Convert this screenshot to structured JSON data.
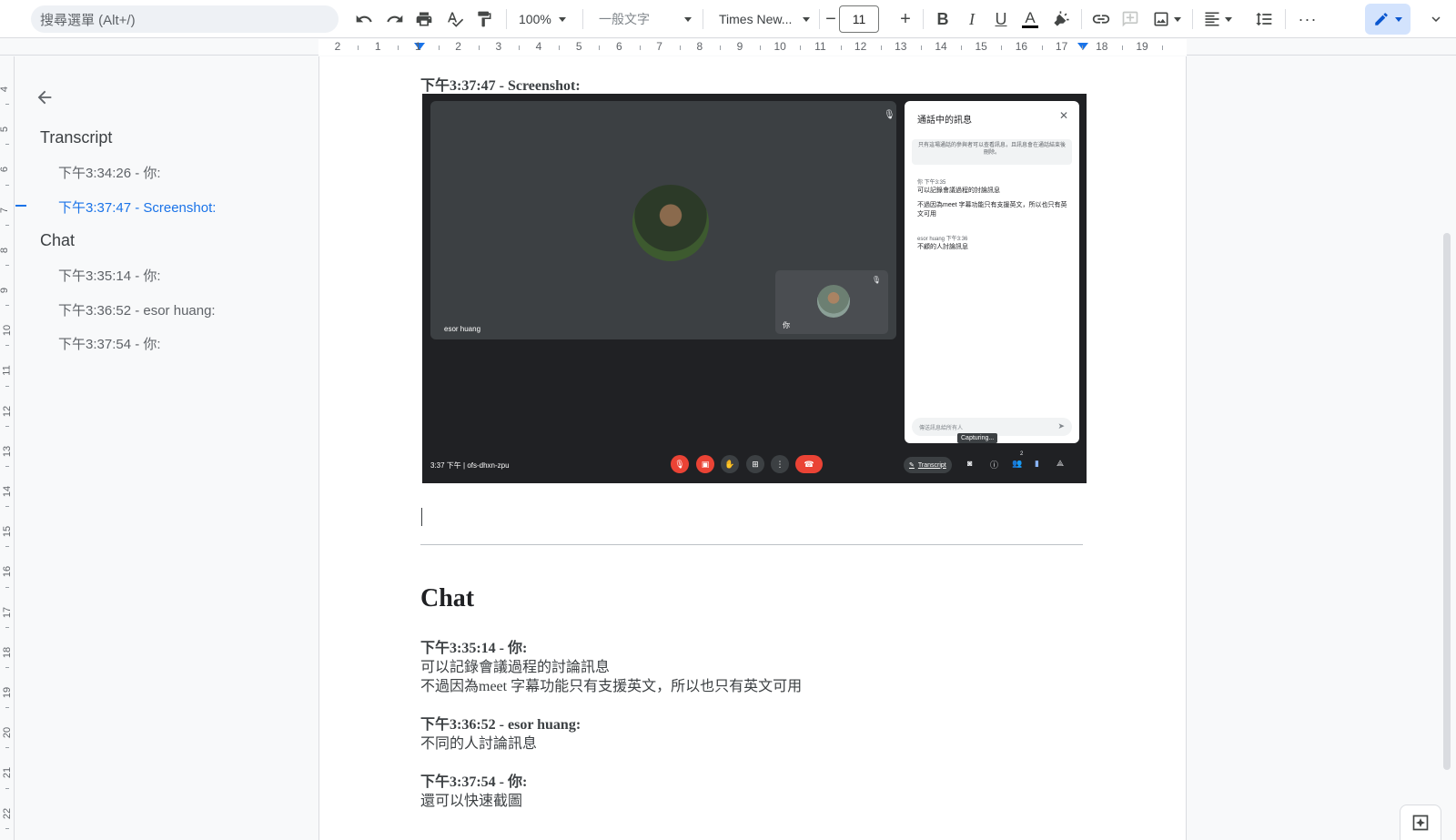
{
  "toolbar": {
    "menu_search": "搜尋選單 (Alt+/)",
    "zoom": "100%",
    "style": "一般文字",
    "font": "Times New...",
    "font_size": "11"
  },
  "ruler": {
    "h_numbers": [
      "2",
      "1",
      "1",
      "2",
      "3",
      "4",
      "5",
      "6",
      "7",
      "8",
      "9",
      "10",
      "11",
      "12",
      "13",
      "14",
      "15",
      "16",
      "17",
      "18",
      "19"
    ],
    "v_numbers": [
      "4",
      "5",
      "6",
      "7",
      "8",
      "9",
      "10",
      "11",
      "12",
      "13",
      "14",
      "15",
      "16",
      "17",
      "18",
      "19",
      "20",
      "21",
      "22"
    ]
  },
  "outline": {
    "headings": [
      {
        "title": "Transcript",
        "items": [
          {
            "label": "下午3:34:26 - 你:",
            "active": false
          },
          {
            "label": "下午3:37:47 - Screenshot:",
            "active": true
          }
        ]
      },
      {
        "title": "Chat",
        "items": [
          {
            "label": "下午3:35:14 - 你:",
            "active": false
          },
          {
            "label": "下午3:36:52 - esor huang:",
            "active": false
          },
          {
            "label": "下午3:37:54 - 你:",
            "active": false
          }
        ]
      }
    ]
  },
  "document": {
    "screenshot_label": "下午3:37:47 - Screenshot:",
    "screenshot": {
      "stage_name": "esor huang",
      "self_name": "你",
      "chat_title": "通話中的訊息",
      "chat_note": "只有這場通話的參與者可以查看訊息，且訊息會在通話結束後刪除。",
      "messages": [
        {
          "meta": "你  下午3:35",
          "lines": [
            "可以記錄會議過程的討論訊息",
            "不過因為meet 字幕功能只有支援英文，所以也只有英文可用"
          ]
        },
        {
          "meta": "esor huang  下午3:36",
          "lines": [
            "不顧的人討論訊息"
          ]
        }
      ],
      "chat_input": "傳送訊息給所有人",
      "capturing": "Capturing...",
      "time_code": "3:37 下午  |  ofs-dhxn-zpu",
      "transcript_chip": "Transcript",
      "participant_count": "2"
    },
    "chat_heading": "Chat",
    "chat_entries": [
      {
        "header": "下午3:35:14 - 你:",
        "lines": [
          "可以記錄會議過程的討論訊息",
          "不過因為meet 字幕功能只有支援英文，所以也只有英文可用"
        ]
      },
      {
        "header": "下午3:36:52 - esor huang:",
        "lines": [
          "不同的人討論訊息"
        ]
      },
      {
        "header": "下午3:37:54 - 你:",
        "lines": [
          "還可以快速截圖"
        ]
      }
    ]
  }
}
